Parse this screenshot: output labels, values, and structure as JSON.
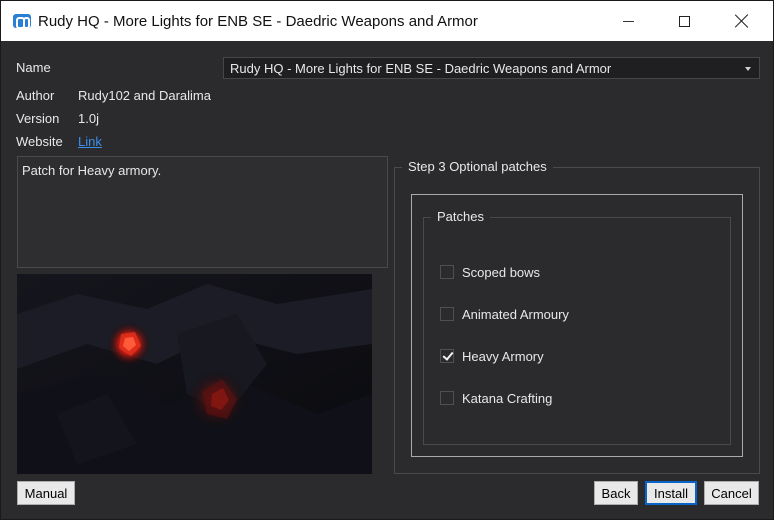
{
  "window": {
    "title": "Rudy HQ - More Lights for ENB SE - Daedric Weapons and Armor"
  },
  "info": {
    "name_label": "Name",
    "name_value": "Rudy HQ - More Lights for ENB SE - Daedric Weapons and Armor",
    "author_label": "Author",
    "author_value": "Rudy102 and Daralima",
    "version_label": "Version",
    "version_value": "1.0j",
    "website_label": "Website",
    "website_link": "Link"
  },
  "description": "Patch for Heavy armory.",
  "step": {
    "legend": "Step 3 Optional patches",
    "group_legend": "Patches",
    "options": [
      {
        "label": "Scoped bows",
        "checked": false
      },
      {
        "label": "Animated Armoury",
        "checked": false
      },
      {
        "label": "Heavy Armory",
        "checked": true
      },
      {
        "label": "Katana Crafting",
        "checked": false
      }
    ]
  },
  "buttons": {
    "manual": "Manual",
    "back": "Back",
    "install": "Install",
    "cancel": "Cancel"
  },
  "colors": {
    "background": "#2b2b2e",
    "link": "#3b8eea",
    "accent": "#0a64c8",
    "ember": "#d4251a"
  }
}
